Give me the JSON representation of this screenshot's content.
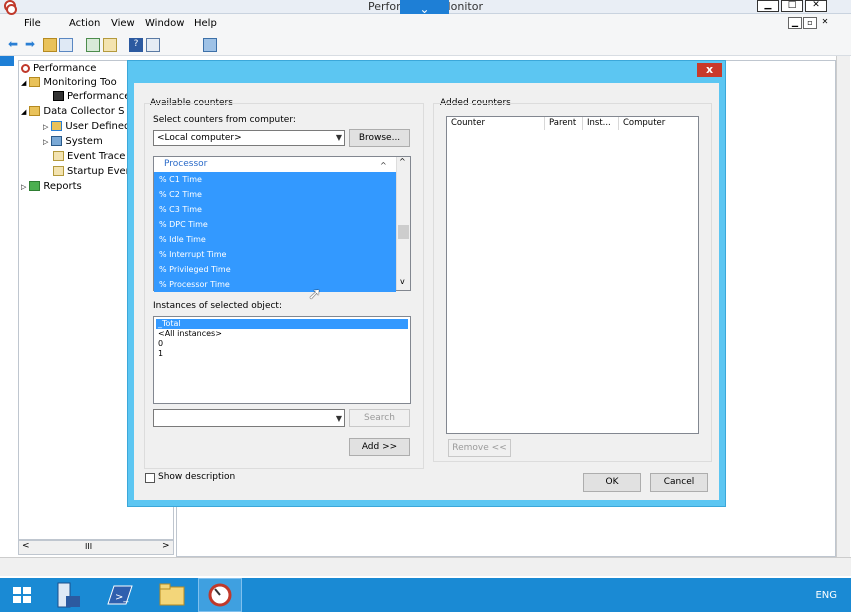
{
  "window": {
    "title": "Performance Monitor",
    "dropdown_glyph": "⌄",
    "controls": [
      "▁",
      "□",
      "✕"
    ],
    "mdi_controls": [
      "▁",
      "▫",
      "✕"
    ]
  },
  "menu": {
    "items": [
      "File",
      "Action",
      "View",
      "Window",
      "Help"
    ]
  },
  "toolbar": {
    "icons": [
      "back-arrow-icon",
      "forward-arrow-icon",
      "up-folder-icon",
      "show-hide-tree-icon",
      "properties-icon",
      "export-icon",
      "help-icon",
      "view-icon",
      "new-window-icon"
    ]
  },
  "tree": {
    "items": [
      {
        "label": "Performance",
        "level": 0,
        "expander": ""
      },
      {
        "label": "Monitoring Too",
        "level": 1,
        "expander": "◢"
      },
      {
        "label": "Performance",
        "level": 2,
        "expander": ""
      },
      {
        "label": "Data Collector S",
        "level": 1,
        "expander": "◢"
      },
      {
        "label": "User Defined",
        "level": 2,
        "expander": "▷"
      },
      {
        "label": "System",
        "level": 2,
        "expander": "▷"
      },
      {
        "label": "Event Trace",
        "level": 2,
        "expander": ""
      },
      {
        "label": "Startup Even",
        "level": 2,
        "expander": ""
      },
      {
        "label": "Reports",
        "level": 1,
        "expander": "▷"
      }
    ],
    "scroll_thumb": "III"
  },
  "dialog": {
    "close_glyph": "x",
    "available_counters": "Available counters",
    "select_computer_label": "Select counters from computer:",
    "computer_value": "<Local computer>",
    "browse_label": "Browse...",
    "object_header": "Processor",
    "counters": [
      "% C1 Time",
      "% C2 Time",
      "% C3 Time",
      "% DPC Time",
      "% Idle Time",
      "% Interrupt Time",
      "% Privileged Time",
      "% Processor Time"
    ],
    "instances_label": "Instances of selected object:",
    "instances": [
      "_Total",
      "<All instances>",
      "0",
      "1"
    ],
    "search_label": "Search",
    "add_label": "Add >>",
    "added_counters": "Added counters",
    "columns": [
      "Counter",
      "Parent",
      "Inst...",
      "Computer"
    ],
    "remove_label": "Remove <<",
    "ok_label": "OK",
    "cancel_label": "Cancel",
    "show_description": "Show description"
  },
  "taskbar": {
    "lang": "ENG"
  }
}
